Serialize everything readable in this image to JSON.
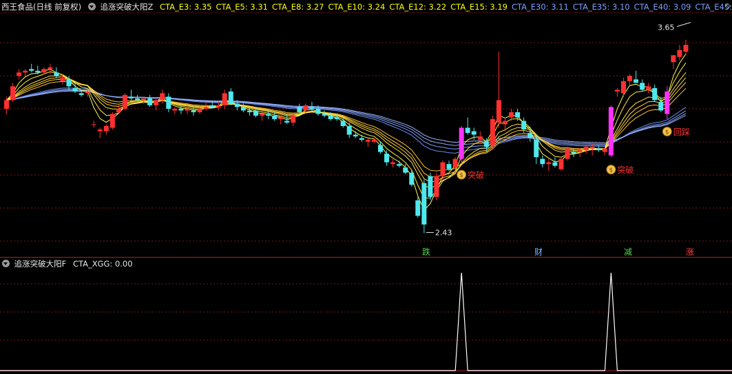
{
  "header": {
    "stock": "西王食品(日线 前复权)",
    "indicator": "追涨突破大阳Z",
    "ma_items": [
      {
        "label": "CTA_E3: 3.35",
        "color": "#ffff00"
      },
      {
        "label": "CTA_E5: 3.31",
        "color": "#ffff00"
      },
      {
        "label": "CTA_E8: 3.27",
        "color": "#ffff00"
      },
      {
        "label": "CTA_E10: 3.24",
        "color": "#ffff00"
      },
      {
        "label": "CTA_E12: 3.22",
        "color": "#ffff00"
      },
      {
        "label": "CTA_E15: 3.19",
        "color": "#ffff00"
      },
      {
        "label": "CTA_E30: 3.11",
        "color": "#7a9fff"
      },
      {
        "label": "CTA_E35: 3.10",
        "color": "#7a9fff"
      },
      {
        "label": "CTA_E40: 3.09",
        "color": "#7a9fff"
      },
      {
        "label": "CTA_E45:",
        "color": "#7a9fff"
      }
    ],
    "more_icon": "diamond-icon"
  },
  "price_panel": {
    "high_label": "3.65",
    "low_label": "2.43",
    "signal_labels": [
      {
        "text": "突破"
      },
      {
        "text": "突破"
      },
      {
        "text": "回踩"
      }
    ],
    "signal_icon": "money-bag-icon",
    "markers": [
      {
        "text": "跌",
        "color": "#4fd34f"
      },
      {
        "text": "财",
        "color": "#7ab6ff"
      },
      {
        "text": "减",
        "color": "#4fd34f"
      },
      {
        "text": "涨",
        "color": "#ff4040"
      }
    ]
  },
  "sub_panel": {
    "indicator": "追涨突破大阳F",
    "value_label": "CTA_XGG: 0.00",
    "value_color": "#e6e6e6"
  },
  "colors": {
    "up": "#ff3030",
    "down": "#4ee8ee",
    "breakout": "#ff33ff",
    "short_ma": "#ffff44",
    "long_ma": "#7a9fff",
    "grid": "#7a1a1a",
    "separator": "#b02020"
  },
  "chart_data": {
    "type": "candlestick",
    "ohlc": [
      [
        3.15,
        3.22,
        3.12,
        3.2
      ],
      [
        3.2,
        3.3,
        3.19,
        3.28
      ],
      [
        3.34,
        3.38,
        3.32,
        3.36
      ],
      [
        3.36,
        3.38,
        3.34,
        3.37
      ],
      [
        3.38,
        3.41,
        3.36,
        3.37
      ],
      [
        3.37,
        3.4,
        3.35,
        3.36
      ],
      [
        3.36,
        3.39,
        3.35,
        3.38
      ],
      [
        3.38,
        3.41,
        3.35,
        3.39
      ],
      [
        3.36,
        3.39,
        3.33,
        3.34
      ],
      [
        3.31,
        3.35,
        3.29,
        3.33
      ],
      [
        3.32,
        3.34,
        3.26,
        3.28
      ],
      [
        3.27,
        3.3,
        3.24,
        3.25
      ],
      [
        3.24,
        3.26,
        3.22,
        3.23
      ],
      [
        3.24,
        3.26,
        3.22,
        3.25
      ],
      [
        3.06,
        3.08,
        3.04,
        3.06
      ],
      [
        3.02,
        3.04,
        2.98,
        3.03
      ],
      [
        3.02,
        3.06,
        3.0,
        3.05
      ],
      [
        3.04,
        3.13,
        3.03,
        3.12
      ],
      [
        3.13,
        3.17,
        3.12,
        3.15
      ],
      [
        3.15,
        3.24,
        3.14,
        3.23
      ],
      [
        3.22,
        3.26,
        3.2,
        3.21
      ],
      [
        3.21,
        3.23,
        3.19,
        3.2
      ],
      [
        3.2,
        3.22,
        3.18,
        3.21
      ],
      [
        3.21,
        3.23,
        3.16,
        3.17
      ],
      [
        3.17,
        3.21,
        3.14,
        3.2
      ],
      [
        3.2,
        3.26,
        3.18,
        3.24
      ],
      [
        3.22,
        3.24,
        3.13,
        3.15
      ],
      [
        3.14,
        3.16,
        3.12,
        3.15
      ],
      [
        3.15,
        3.17,
        3.12,
        3.14
      ],
      [
        3.14,
        3.17,
        3.12,
        3.15
      ],
      [
        3.14,
        3.16,
        3.11,
        3.13
      ],
      [
        3.13,
        3.16,
        3.12,
        3.15
      ],
      [
        3.15,
        3.19,
        3.14,
        3.16
      ],
      [
        3.17,
        3.19,
        3.15,
        3.16
      ],
      [
        3.16,
        3.19,
        3.14,
        3.17
      ],
      [
        3.17,
        3.26,
        3.15,
        3.24
      ],
      [
        3.25,
        3.27,
        3.17,
        3.18
      ],
      [
        3.18,
        3.2,
        3.14,
        3.16
      ],
      [
        3.16,
        3.18,
        3.13,
        3.14
      ],
      [
        3.14,
        3.16,
        3.11,
        3.13
      ],
      [
        3.14,
        3.16,
        3.1,
        3.11
      ],
      [
        3.11,
        3.13,
        3.08,
        3.12
      ],
      [
        3.12,
        3.14,
        3.09,
        3.11
      ],
      [
        3.11,
        3.13,
        3.08,
        3.09
      ],
      [
        3.09,
        3.11,
        3.06,
        3.1
      ],
      [
        3.08,
        3.12,
        3.06,
        3.07
      ],
      [
        3.07,
        3.12,
        3.05,
        3.11
      ],
      [
        3.16,
        3.18,
        3.12,
        3.13
      ],
      [
        3.14,
        3.18,
        3.12,
        3.17
      ],
      [
        3.16,
        3.19,
        3.14,
        3.15
      ],
      [
        3.15,
        3.17,
        3.11,
        3.12
      ],
      [
        3.12,
        3.14,
        3.1,
        3.11
      ],
      [
        3.11,
        3.13,
        3.08,
        3.09
      ],
      [
        3.1,
        3.12,
        3.08,
        3.09
      ],
      [
        3.08,
        3.1,
        3.04,
        3.05
      ],
      [
        3.05,
        3.07,
        2.98,
        3.0
      ],
      [
        3.0,
        3.02,
        2.98,
        2.99
      ],
      [
        2.98,
        3.0,
        2.96,
        2.97
      ],
      [
        2.96,
        2.98,
        2.93,
        2.97
      ],
      [
        2.96,
        2.98,
        2.95,
        2.97
      ],
      [
        2.94,
        2.96,
        2.89,
        2.9
      ],
      [
        2.89,
        2.91,
        2.82,
        2.84
      ],
      [
        2.83,
        2.86,
        2.81,
        2.84
      ],
      [
        2.83,
        2.85,
        2.81,
        2.82
      ],
      [
        2.81,
        2.83,
        2.77,
        2.78
      ],
      [
        2.78,
        2.8,
        2.7,
        2.71
      ],
      [
        2.62,
        2.64,
        2.52,
        2.53
      ],
      [
        2.72,
        2.74,
        2.43,
        2.48
      ],
      [
        2.76,
        2.78,
        2.62,
        2.64
      ],
      [
        2.64,
        2.78,
        2.62,
        2.76
      ],
      [
        2.76,
        2.85,
        2.74,
        2.84
      ],
      [
        2.83,
        2.85,
        2.79,
        2.8
      ],
      [
        2.81,
        2.87,
        2.79,
        2.86
      ],
      [
        2.86,
        3.05,
        2.84,
        3.04
      ],
      [
        3.04,
        3.1,
        3.0,
        3.01
      ],
      [
        3.02,
        3.04,
        2.97,
        3.0
      ],
      [
        2.97,
        3.02,
        2.95,
        2.99
      ],
      [
        2.96,
        2.98,
        2.9,
        2.93
      ],
      [
        2.94,
        3.11,
        2.92,
        3.09
      ],
      [
        3.07,
        3.48,
        3.04,
        3.2
      ],
      [
        3.06,
        3.1,
        3.02,
        3.08
      ],
      [
        3.1,
        3.15,
        3.08,
        3.13
      ],
      [
        3.13,
        3.15,
        3.08,
        3.1
      ],
      [
        3.08,
        3.1,
        3.01,
        3.03
      ],
      [
        3.01,
        3.04,
        2.96,
        2.98
      ],
      [
        2.97,
        3.0,
        2.83,
        2.87
      ],
      [
        2.86,
        2.88,
        2.81,
        2.83
      ],
      [
        2.83,
        2.86,
        2.79,
        2.84
      ],
      [
        2.84,
        2.87,
        2.81,
        2.82
      ],
      [
        2.8,
        2.87,
        2.79,
        2.86
      ],
      [
        2.86,
        2.93,
        2.85,
        2.92
      ],
      [
        2.9,
        2.92,
        2.87,
        2.89
      ],
      [
        2.9,
        2.92,
        2.87,
        2.91
      ],
      [
        2.91,
        2.94,
        2.89,
        2.93
      ],
      [
        2.92,
        2.95,
        2.88,
        2.93
      ],
      [
        2.92,
        2.94,
        2.9,
        2.91
      ],
      [
        2.9,
        2.93,
        2.88,
        2.92
      ],
      [
        2.88,
        3.17,
        2.87,
        3.16
      ],
      [
        3.25,
        3.27,
        3.22,
        3.26
      ],
      [
        3.24,
        3.33,
        3.22,
        3.31
      ],
      [
        3.31,
        3.35,
        3.29,
        3.34
      ],
      [
        3.32,
        3.37,
        3.3,
        3.3
      ],
      [
        3.3,
        3.32,
        3.25,
        3.26
      ],
      [
        3.26,
        3.3,
        3.24,
        3.28
      ],
      [
        3.27,
        3.29,
        3.19,
        3.2
      ],
      [
        3.19,
        3.22,
        3.13,
        3.14
      ],
      [
        3.12,
        3.28,
        3.09,
        3.25
      ],
      [
        3.42,
        3.46,
        3.38,
        3.46
      ],
      [
        3.45,
        3.52,
        3.43,
        3.49
      ],
      [
        3.48,
        3.55,
        3.46,
        3.52
      ]
    ],
    "breakout_bar_indices": [
      73,
      97,
      106
    ],
    "short_mas": [
      {
        "name": "CTA_E3",
        "period": 3
      },
      {
        "name": "CTA_E5",
        "period": 5
      },
      {
        "name": "CTA_E8",
        "period": 8
      },
      {
        "name": "CTA_E10",
        "period": 10
      },
      {
        "name": "CTA_E12",
        "period": 12
      },
      {
        "name": "CTA_E15",
        "period": 15
      }
    ],
    "long_mas": [
      {
        "name": "CTA_E30",
        "period": 30
      },
      {
        "name": "CTA_E35",
        "period": 35
      },
      {
        "name": "CTA_E40",
        "period": 40
      },
      {
        "name": "CTA_E45",
        "period": 45
      }
    ],
    "high": {
      "value": 3.65,
      "bar_index": 110
    },
    "low": {
      "value": 2.43,
      "bar_index": 67
    },
    "sub_series": {
      "name": "CTA_XGG",
      "spike_bar_indices": [
        73,
        97
      ]
    }
  }
}
